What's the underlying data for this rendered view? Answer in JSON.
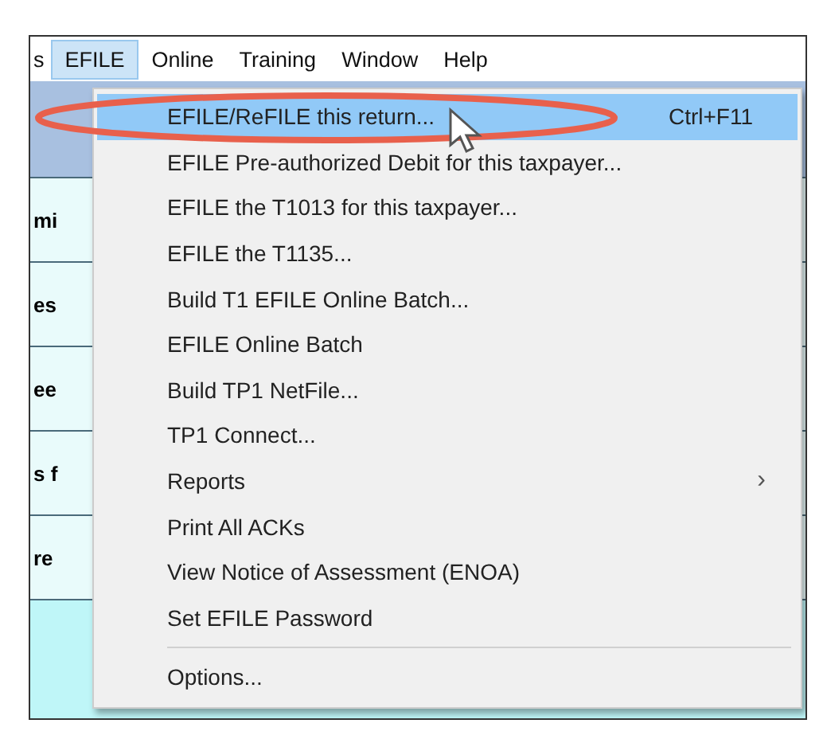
{
  "menubar": [
    {
      "label": "s",
      "selected": false
    },
    {
      "label": "EFILE",
      "selected": true
    },
    {
      "label": "Online",
      "selected": false
    },
    {
      "label": "Training",
      "selected": false
    },
    {
      "label": "Window",
      "selected": false
    },
    {
      "label": "Help",
      "selected": false
    }
  ],
  "background_fragments": [
    "mi",
    "es",
    "ee",
    "s f",
    "re"
  ],
  "menu": [
    {
      "kind": "item",
      "label": "EFILE/ReFILE this return...",
      "shortcut": "Ctrl+F11",
      "selected": true
    },
    {
      "kind": "item",
      "label": "EFILE Pre-authorized Debit for this taxpayer...",
      "selected": false
    },
    {
      "kind": "item",
      "label": "EFILE the T1013 for this taxpayer...",
      "selected": false
    },
    {
      "kind": "item",
      "label": "EFILE the T1135...",
      "selected": false
    },
    {
      "kind": "item",
      "label": "Build T1 EFILE Online Batch...",
      "selected": false
    },
    {
      "kind": "item",
      "label": "EFILE Online Batch",
      "selected": false
    },
    {
      "kind": "item",
      "label": "Build TP1 NetFile...",
      "selected": false
    },
    {
      "kind": "item",
      "label": "TP1 Connect...",
      "selected": false
    },
    {
      "kind": "submenu",
      "label": "Reports",
      "arrow": "›",
      "selected": false
    },
    {
      "kind": "item",
      "label": "Print All ACKs",
      "selected": false
    },
    {
      "kind": "item",
      "label": "View Notice of Assessment (ENOA)",
      "selected": false
    },
    {
      "kind": "item",
      "label": "Set EFILE Password",
      "selected": false
    },
    {
      "kind": "separator"
    },
    {
      "kind": "item",
      "label": "Options...",
      "selected": false
    }
  ]
}
